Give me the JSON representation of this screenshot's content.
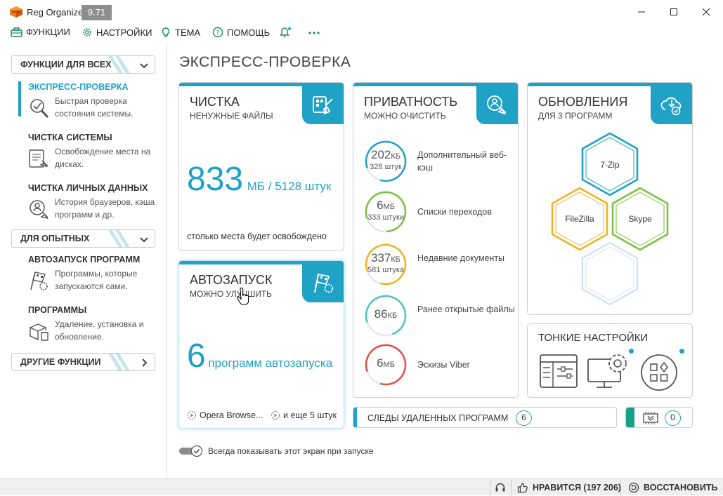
{
  "app": {
    "title": "Reg Organizer",
    "version": "9.71"
  },
  "menu": [
    {
      "label": "ФУНКЦИИ",
      "icon": "toolbox-icon"
    },
    {
      "label": "НАСТРОЙКИ",
      "icon": "gear-icon"
    },
    {
      "label": "ТЕМА",
      "icon": "lightbulb-icon"
    },
    {
      "label": "ПОМОЩЬ",
      "icon": "help-icon"
    }
  ],
  "sidebar": {
    "sections": [
      {
        "label": "ФУНКЦИИ ДЛЯ ВСЕХ"
      },
      {
        "label": "ДЛЯ ОПЫТНЫХ"
      },
      {
        "label": "ДРУГИЕ ФУНКЦИИ"
      }
    ],
    "items": [
      {
        "title": "ЭКСПРЕСС-ПРОВЕРКА",
        "desc": "Быстрая проверка состояния системы.",
        "icon": "magnifier-check-icon",
        "active": true
      },
      {
        "title": "ЧИСТКА СИСТЕМЫ",
        "desc": "Освобождение места на дисках.",
        "icon": "disk-cleanup-icon"
      },
      {
        "title": "ЧИСТКА ЛИЧНЫХ ДАННЫХ",
        "desc": "История браузеров, кэша программ и др.",
        "icon": "privacy-cleanup-icon"
      },
      {
        "title": "АВТОЗАПУСК ПРОГРАММ",
        "desc": "Программы, которые запускаются сами.",
        "icon": "autorun-flag-icon"
      },
      {
        "title": "ПРОГРАММЫ",
        "desc": "Удаление, установка и обновление.",
        "icon": "programs-box-icon"
      }
    ]
  },
  "main": {
    "title": "ЭКСПРЕСС-ПРОВЕРКА",
    "cleanup": {
      "title": "ЧИСТКА",
      "subtitle": "НЕНУЖНЫЕ ФАЙЛЫ",
      "value": "833",
      "unit": "МБ / 5128 штук",
      "note": "столько места будет освобождено"
    },
    "autorun": {
      "title": "АВТОЗАПУСК",
      "subtitle": "МОЖНО УЛУЧШИТЬ",
      "value": "6",
      "unit": "программ автозапуска",
      "app1": "Opera Browse...",
      "app2": "и еще 5 штук"
    },
    "privacy": {
      "title": "ПРИВАТНОСТЬ",
      "subtitle": "МОЖНО ОЧИСТИТЬ",
      "rows": [
        {
          "value": "202",
          "unit": "КБ",
          "count": "328 штук",
          "label": "Дополнительный веб-кэш",
          "color": "#1fa2c5",
          "fill": 0.85
        },
        {
          "value": "6",
          "unit": "МБ",
          "count": "333 штуки",
          "label": "Списки переходов",
          "color": "#7cc142",
          "fill": 0.8
        },
        {
          "value": "337",
          "unit": "КБ",
          "count": "581 штука",
          "label": "Недавние документы",
          "color": "#f0b323",
          "fill": 0.85
        },
        {
          "value": "86",
          "unit": "КБ",
          "count": "",
          "label": "Ранее открытые файлы",
          "color": "#4cc4c4",
          "fill": 0.75
        },
        {
          "value": "6",
          "unit": "МБ",
          "count": "",
          "label": "Эскизы Viber",
          "color": "#e0504a",
          "fill": 0.85
        }
      ]
    },
    "updates": {
      "title": "ОБНОВЛЕНИЯ",
      "subtitle": "ДЛЯ 3 ПРОГРАММ",
      "apps": [
        "7-Zip",
        "FileZilla",
        "Skype"
      ]
    },
    "tweaks": {
      "title": "ТОНКИЕ НАСТРОЙКИ"
    },
    "traces": {
      "label": "СЛЕДЫ УДАЛЕННЫХ ПРОГРАММ",
      "count": "6"
    },
    "chip_count": "0",
    "toggle_label": "Всегда показывать этот экран при запуске"
  },
  "status": {
    "likes": "НРАВИТСЯ (197 206)",
    "restore": "ВОССТАНОВИТЬ"
  }
}
